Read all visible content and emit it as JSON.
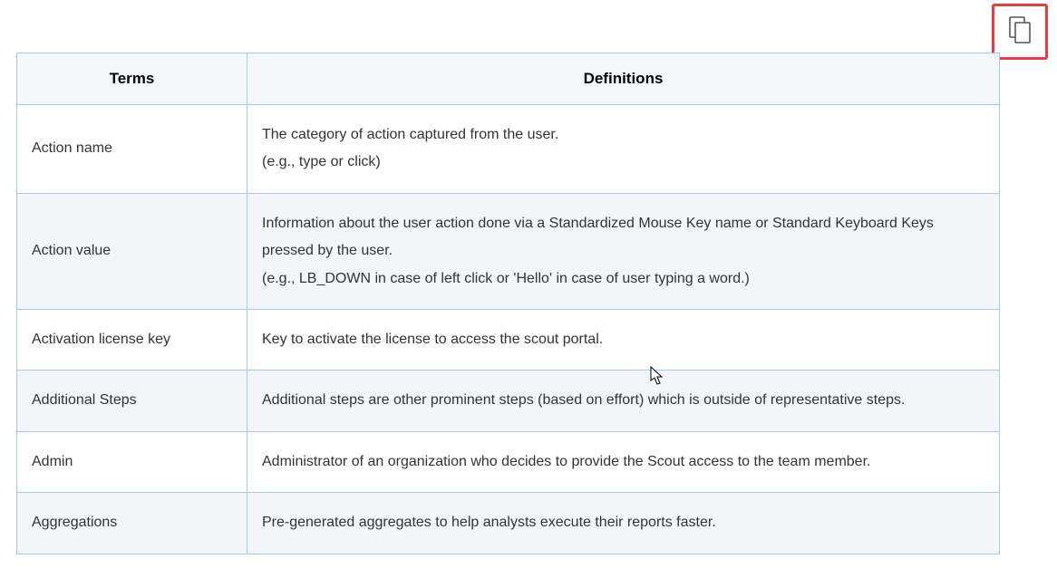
{
  "headers": {
    "terms": "Terms",
    "definitions": "Definitions"
  },
  "rows": [
    {
      "term": "Action name",
      "def_line1": "The category of action captured from the user.",
      "def_line2": "(e.g., type or click)"
    },
    {
      "term": "Action value",
      "def_line1": "Information about the user action done via a Standardized Mouse Key name or Standard Keyboard Keys pressed by the user.",
      "def_line2": "(e.g., LB_DOWN in case of left click or 'Hello' in case of user typing a word.)"
    },
    {
      "term": "Activation license key",
      "def_line1": "Key to activate the license to access the scout portal.",
      "def_line2": ""
    },
    {
      "term": "Additional Steps",
      "def_line1": "Additional steps are other prominent steps (based on effort) which is outside of representative steps.",
      "def_line2": ""
    },
    {
      "term": "Admin",
      "def_line1": "Administrator of an organization who decides to provide the Scout access to the team member.",
      "def_line2": ""
    },
    {
      "term": "Aggregations",
      "def_line1": "Pre-generated aggregates to help analysts execute their reports faster.",
      "def_line2": ""
    }
  ]
}
